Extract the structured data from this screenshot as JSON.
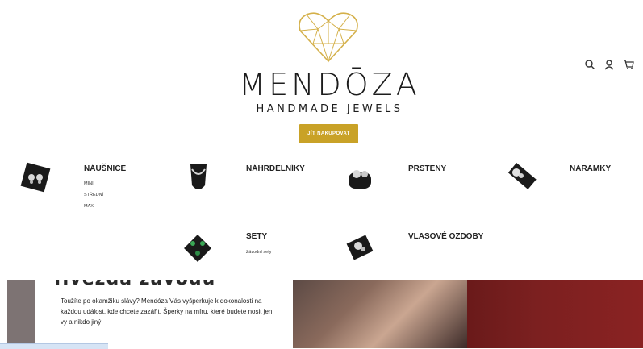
{
  "brand": {
    "name": "MENDŌZA",
    "tagline": "HANDMADE JEWELS",
    "cta_label": "JÍT NAKUPOVAT",
    "accent_color": "#c9a227"
  },
  "header_icons": [
    "search-icon",
    "user-icon",
    "cart-icon"
  ],
  "categories": [
    {
      "title": "NÁUŠNICE",
      "subs": [
        "MINI",
        "STŘEDNÍ",
        "MAXI"
      ]
    },
    {
      "title": "NÁHRDELNÍKY",
      "subs": []
    },
    {
      "title": "PRSTENY",
      "subs": []
    },
    {
      "title": "NÁRAMKY",
      "subs": []
    },
    {
      "title": "SETY",
      "subs": [
        "Závodní sety"
      ]
    },
    {
      "title": "VLASOVÉ OZDOBY",
      "subs": []
    }
  ],
  "lower": {
    "heading": "Hvězda závodů",
    "paragraph": "Toužíte po okamžiku slávy? Mendóza Vás vyšperkuje k dokonalosti na každou událost, kde chcete zazářit. Šperky na míru, které budete nosit jen vy a nikdo jiný."
  }
}
